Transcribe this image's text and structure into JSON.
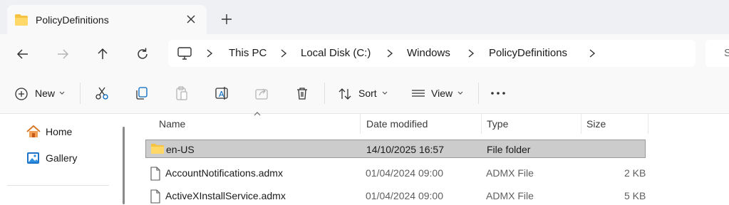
{
  "tab": {
    "title": "PolicyDefinitions",
    "icon": "folder-icon",
    "close_glyph": "✕",
    "new_tab_glyph": "+"
  },
  "address_bar": {
    "breadcrumbs": [
      "This PC",
      "Local Disk (C:)",
      "Windows",
      "PolicyDefinitions"
    ],
    "search_partial": "S"
  },
  "toolbar": {
    "new_label": "New",
    "sort_label": "Sort",
    "view_label": "View",
    "more_glyph": "···"
  },
  "sidebar": {
    "items": [
      {
        "label": "Home",
        "icon": "home-icon"
      },
      {
        "label": "Gallery",
        "icon": "gallery-icon"
      }
    ]
  },
  "file_list": {
    "columns": [
      "Name",
      "Date modified",
      "Type",
      "Size"
    ],
    "rows": [
      {
        "name": "en-US",
        "date": "14/10/2025 16:57",
        "type": "File folder",
        "size": "",
        "icon": "folder-icon",
        "selected": true
      },
      {
        "name": "AccountNotifications.admx",
        "date": "01/04/2024 09:00",
        "type": "ADMX File",
        "size": "2 KB",
        "icon": "file-icon",
        "selected": false
      },
      {
        "name": "ActiveXInstallService.admx",
        "date": "01/04/2024 09:00",
        "type": "ADMX File",
        "size": "5 KB",
        "icon": "file-icon",
        "selected": false
      }
    ]
  },
  "colors": {
    "folder": "#f5c242",
    "selection": "#cccccc",
    "accent": "#0067c0"
  }
}
